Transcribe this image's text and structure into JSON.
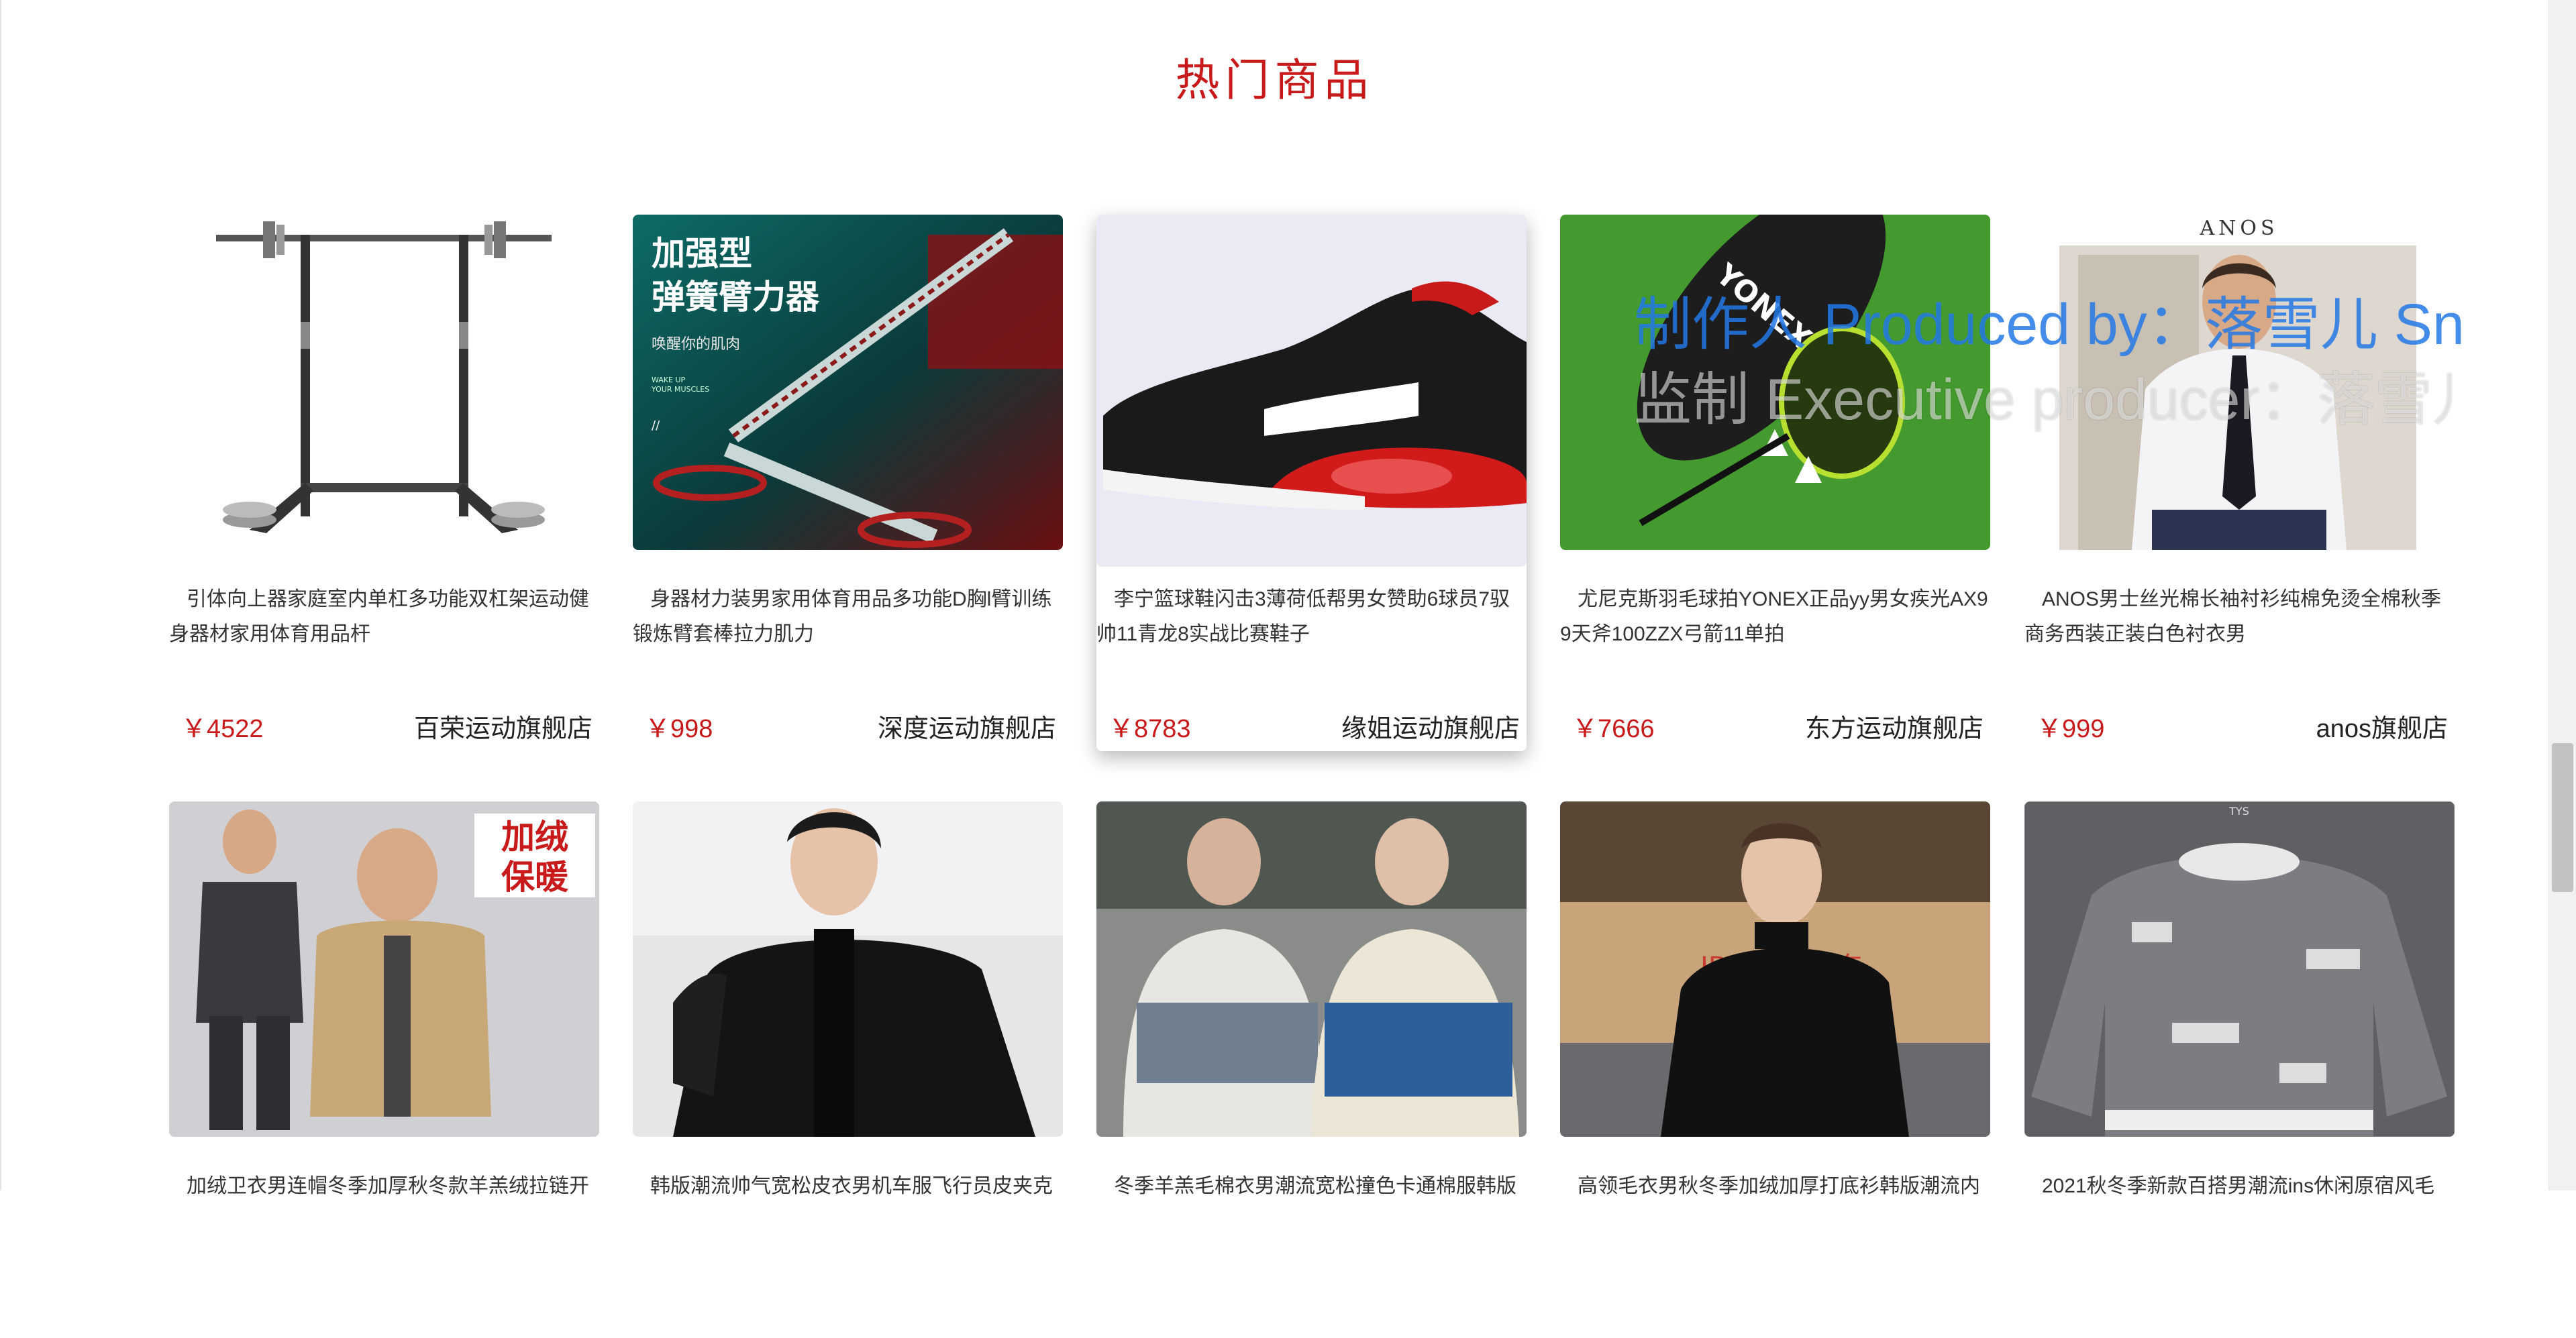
{
  "section": {
    "title": "热门商品"
  },
  "products": [
    {
      "title": "引体向上器家庭室内单杠多功能双杠架运动健身器材家用体育用品杆",
      "price": "￥4522",
      "shop": "百荣运动旗舰店"
    },
    {
      "title": "身器材力装男家用体育用品多功能D胸l臂训练锻炼臂套棒拉力肌力",
      "price": "￥998",
      "shop": "深度运动旗舰店",
      "image_text": [
        "加强型",
        "弹簧臂力器",
        "唤醒你的肌肉",
        "WAKE UP",
        "YOUR MUSCLES",
        "//"
      ]
    },
    {
      "title": "李宁篮球鞋闪击3薄荷低帮男女赞助6球员7驭帅11青龙8实战比赛鞋子",
      "price": "￥8783",
      "shop": "缘姐运动旗舰店"
    },
    {
      "title": "尤尼克斯羽毛球拍YONEX正品yy男女疾光AX99天斧100ZZX弓箭11单拍",
      "price": "￥7666",
      "shop": "东方运动旗舰店",
      "image_text": [
        "YONEX"
      ]
    },
    {
      "title": "ANOS男士丝光棉长袖衬衫纯棉免烫全棉秋季商务西装正装白色衬衣男",
      "price": "￥999",
      "shop": "anos旗舰店",
      "image_text": [
        "ANOS"
      ]
    },
    {
      "title": "加绒卫衣男连帽冬季加厚秋冬款羊羔绒拉链开",
      "image_text": [
        "加绒",
        "保暖"
      ]
    },
    {
      "title": "韩版潮流帅气宽松皮衣男机车服飞行员皮夹克"
    },
    {
      "title": "冬季羊羔毛棉衣男潮流宽松撞色卡通棉服韩版"
    },
    {
      "title": "高领毛衣男秋冬季加绒加厚打底衫韩版潮流内",
      "image_text": [
        "JD.COM 京东"
      ]
    },
    {
      "title": "2021秋冬季新款百搭男潮流ins休闲原宿风毛",
      "image_text": [
        "TYS"
      ]
    }
  ],
  "watermark": {
    "line1": "制作人 Produced by：落雪儿 Snow",
    "line2": "监制 Executive producer：落雪儿"
  },
  "colors": {
    "accent": "#c81a1a",
    "text": "#333333"
  }
}
